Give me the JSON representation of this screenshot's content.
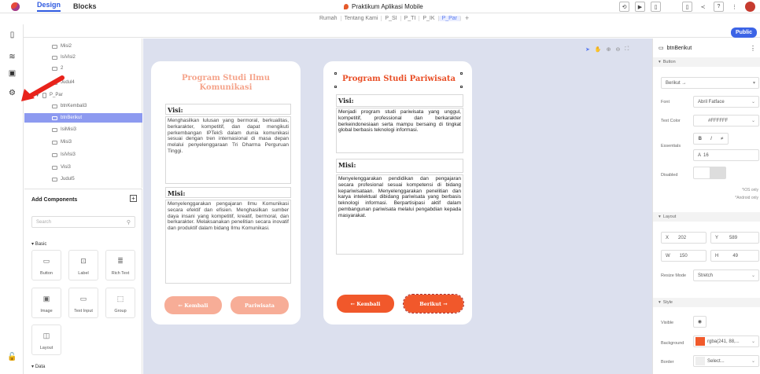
{
  "app": {
    "tabs": [
      {
        "label": "Design",
        "active": true
      },
      {
        "label": "Blocks",
        "active": false
      }
    ],
    "project_title": "Praktikum Aplikasi Mobile",
    "public_label": "Public",
    "accent": "#2f5ae0"
  },
  "pages": {
    "items": [
      {
        "label": "Rumah",
        "active": false
      },
      {
        "label": "Tentang Kami",
        "active": false
      },
      {
        "label": "P_SI",
        "active": false
      },
      {
        "label": "P_TI",
        "active": false
      },
      {
        "label": "P_IK",
        "active": false
      },
      {
        "label": "P_Par",
        "active": true
      }
    ],
    "add_symbol": "+"
  },
  "tree": {
    "rows": [
      {
        "label": "Misi2",
        "selected": false
      },
      {
        "label": "IsiVisi2",
        "selected": false
      },
      {
        "label": "2",
        "selected": false
      },
      {
        "label": "Judul4",
        "selected": false
      },
      {
        "label": "P_Par",
        "selected": false
      },
      {
        "label": "btnKembali3",
        "selected": false
      },
      {
        "label": "btnBerikut",
        "selected": true
      },
      {
        "label": "IsiMisi3",
        "selected": false
      },
      {
        "label": "Misi3",
        "selected": false
      },
      {
        "label": "IsiVisi3",
        "selected": false
      },
      {
        "label": "Visi3",
        "selected": false
      },
      {
        "label": "Judul5",
        "selected": false
      }
    ]
  },
  "components": {
    "title": "Add Components",
    "search_placeholder": "Search",
    "basic_label": "Basic",
    "data_label": "Data",
    "tiles": [
      {
        "label": "Button",
        "icon": "button-icon"
      },
      {
        "label": "Label",
        "icon": "label-icon"
      },
      {
        "label": "Rich Text",
        "icon": "richtext-icon"
      },
      {
        "label": "Image",
        "icon": "image-icon"
      },
      {
        "label": "Text Input",
        "icon": "textinput-icon"
      },
      {
        "label": "Group",
        "icon": "group-icon"
      },
      {
        "label": "Layout",
        "icon": "layout-icon"
      }
    ]
  },
  "phone_left": {
    "title": "Program Studi Ilmu Komunikasi",
    "visi_label": "Visi:",
    "visi_text": "Menghasilkan lulusan yang bermoral, berkualitas, berkarakter, kompetitif, dan dapat mengikuti perkembangan IPTekS dalam dunia komunikasi sesuai dengan tren internasional di masa depan melalui penyelenggaraan Tri Dharma Perguruan Tinggi.",
    "misi_label": "Misi:",
    "misi_text": "Menyelenggarakan pengajaran Ilmu Komunikasi secara efektif dan efisien. Menghasilkan sumber daya insani yang kompetitif, kreatif, bermoral, dan berkarakter. Melaksanakan penelitian secara inovatif dan produktif dalam bidang Ilmu Komunikasi.",
    "btn_back": "← Kembali",
    "btn_next": "Pariwisata",
    "color": "#f7ad97"
  },
  "phone_right": {
    "title": "Program Studi Pariwisata",
    "visi_label": "Visi:",
    "visi_text": "Menjadi program studi pariwisata yang unggul, kompetitif, professional dan berkarakter berkeindonesiaan serta mampu bersaing di tingkat global berbasis teknologi informasi.",
    "misi_label": "Misi:",
    "misi_text": "Menyelenggarakan pendidikan dan pengajaran secara profesional sesuai kompetensi di bidang kepariwisataan. Menyelenggarakan penelitian dan karya intelektual dibidang pariwisata yang berbasis teknologi informasi. Berpartisipasi aktif dalam pembangunan pariwisata melalui pengabdian kepada masyarakat.",
    "btn_back": "← Kembali",
    "btn_next": "Berikut →",
    "color": "#f1582b"
  },
  "props": {
    "component_name": "btnBerikut",
    "button_section": "Button",
    "button_text": "Berikut →",
    "font_label": "Font",
    "font_value": "Abril Fatface",
    "text_color_label": "Text Color",
    "text_color_value": "#FFFFFF",
    "essentials_label": "Essentials",
    "font_size": "16",
    "disabled_label": "Disabled",
    "ios_only": "*iOS only",
    "android_only": "*Android only",
    "layout_section": "Layout",
    "x_label": "X",
    "x_value": "202",
    "y_label": "Y",
    "y_value": "589",
    "w_label": "W",
    "w_value": "150",
    "h_label": "H",
    "h_value": "49",
    "resize_label": "Resize Mode",
    "resize_value": "Stretch",
    "style_section": "Style",
    "visible_label": "Visible",
    "background_label": "Background",
    "background_value": "rgba(241, 88,...",
    "border_label": "Border",
    "border_value": "Select..."
  }
}
